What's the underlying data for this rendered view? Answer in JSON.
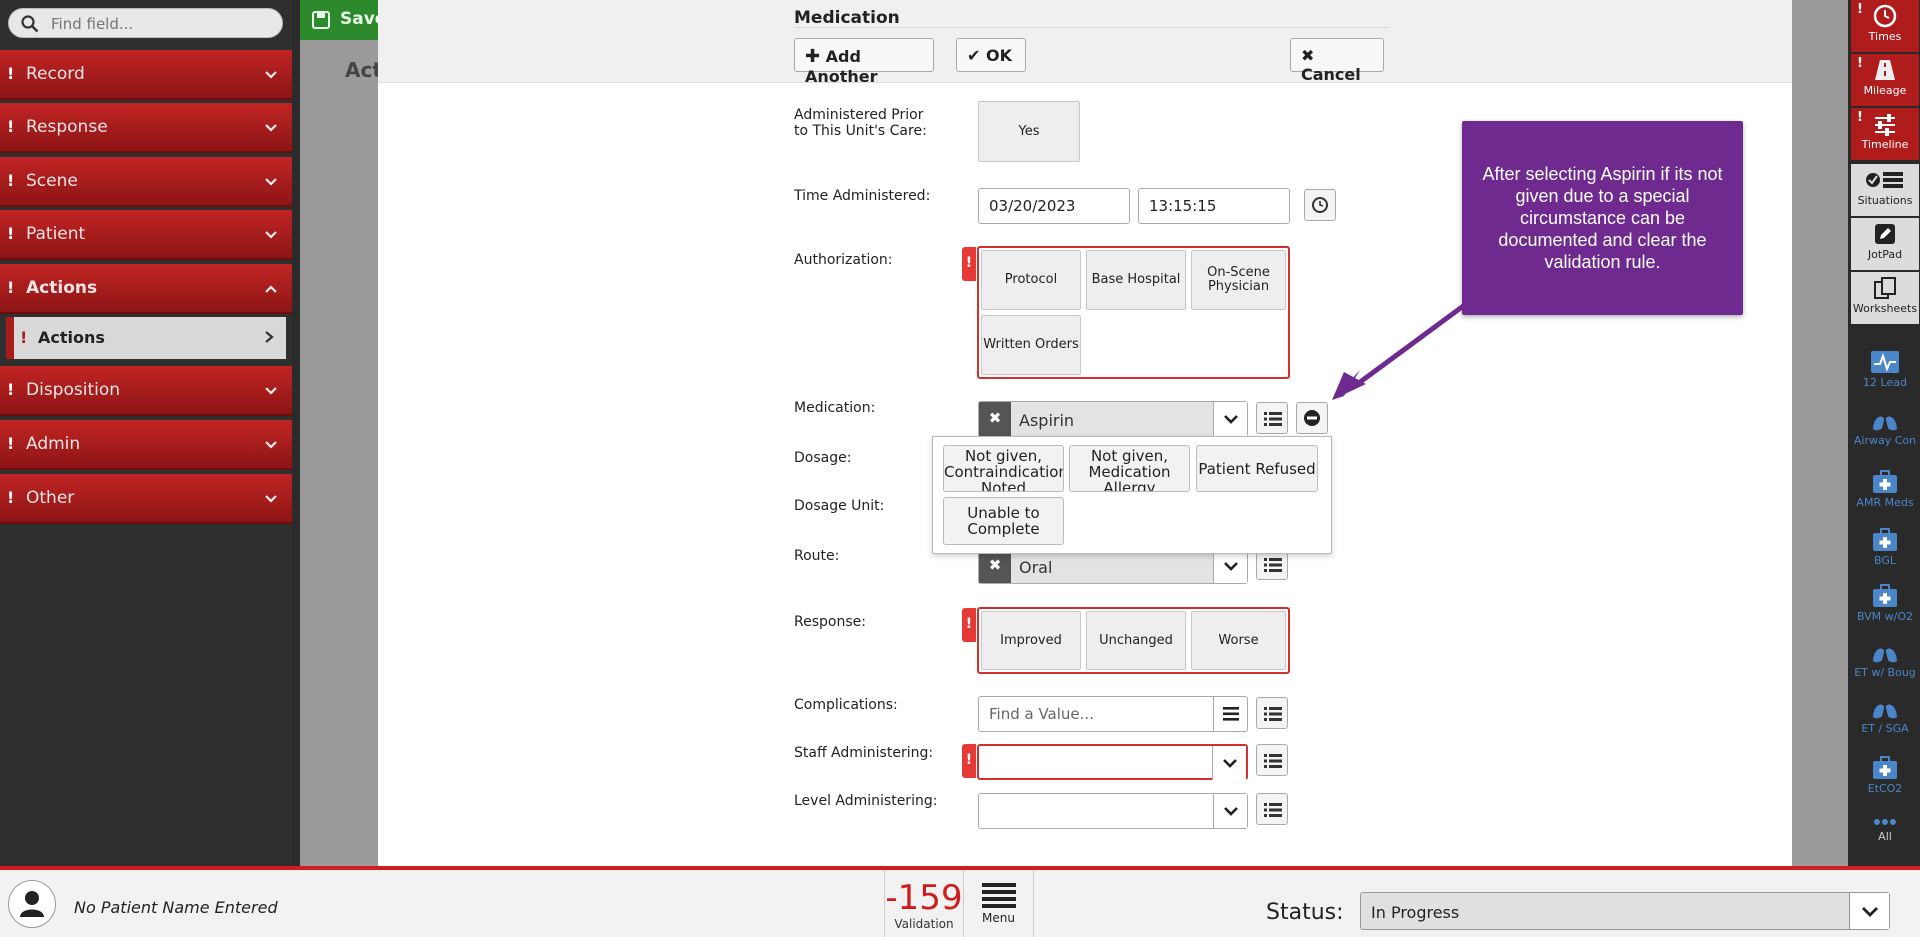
{
  "sidebar": {
    "search_placeholder": "Find field...",
    "items": [
      {
        "label": "Record",
        "alert": "!"
      },
      {
        "label": "Response",
        "alert": "!"
      },
      {
        "label": "Scene",
        "alert": "!"
      },
      {
        "label": "Patient",
        "alert": "!"
      },
      {
        "label": "Actions",
        "alert": "!"
      },
      {
        "label": "Disposition",
        "alert": "!"
      },
      {
        "label": "Admin",
        "alert": "!"
      },
      {
        "label": "Other",
        "alert": "!"
      }
    ],
    "sub_item": {
      "label": "Actions",
      "alert": "!"
    }
  },
  "background": {
    "save_label": "Save",
    "title": "Act"
  },
  "modal": {
    "title": "Medication",
    "add_another": "Add Another",
    "ok": "OK",
    "cancel": "Cancel",
    "fields": {
      "administered_prior_label": "Administered Prior to This Unit's Care:",
      "administered_prior_value": "Yes",
      "time_label": "Time Administered:",
      "date_value": "03/20/2023",
      "time_value": "13:15:15",
      "authorization_label": "Authorization:",
      "authorization_options": [
        "Protocol",
        "Base Hospital",
        "On-Scene Physician",
        "Written Orders"
      ],
      "medication_label": "Medication:",
      "medication_value": "Aspirin",
      "dosage_label": "Dosage:",
      "dosage_unit_label": "Dosage Unit:",
      "route_label": "Route:",
      "route_value": "Oral",
      "response_label": "Response:",
      "response_options": [
        "Improved",
        "Unchanged",
        "Worse"
      ],
      "complications_label": "Complications:",
      "complications_placeholder": "Find a Value...",
      "staff_label": "Staff Administering:",
      "level_label": "Level Administering:"
    },
    "popup_options": [
      "Not given, Contraindication Noted",
      "Not given, Medication Allergy",
      "Patient Refused",
      "Unable to Complete"
    ]
  },
  "callout": {
    "text": "After selecting Aspirin if its not given due to a special circumstance can be documented and clear the validation rule."
  },
  "rightbar": [
    {
      "label": "Times",
      "icon": "clock-icon"
    },
    {
      "label": "Mileage",
      "icon": "road-icon"
    },
    {
      "label": "Timeline",
      "icon": "sliders-icon"
    },
    {
      "label": "Situations",
      "icon": "situations-icon"
    },
    {
      "label": "JotPad",
      "icon": "pencil-icon"
    },
    {
      "label": "Worksheets",
      "icon": "copy-icon"
    },
    {
      "label": "12 Lead",
      "icon": "ecg-icon"
    },
    {
      "label": "Airway Con",
      "icon": "lungs-icon"
    },
    {
      "label": "AMR Meds",
      "icon": "medkit-icon"
    },
    {
      "label": "BGL",
      "icon": "medkit-icon"
    },
    {
      "label": "BVM w/O2",
      "icon": "medkit-icon"
    },
    {
      "label": "ET w/ Boug",
      "icon": "lungs-icon"
    },
    {
      "label": "ET / SGA",
      "icon": "lungs-icon"
    },
    {
      "label": "EtCO2",
      "icon": "medkit-icon"
    },
    {
      "label": "All",
      "icon": "more-icon"
    }
  ],
  "bottom": {
    "patient_name": "No Patient Name Entered",
    "validation_count": "-159",
    "validation_label": "Validation",
    "menu_label": "Menu",
    "status_label": "Status:",
    "status_value": "In Progress"
  },
  "colors": {
    "sidebar_red": "#b01c1c",
    "callout_purple": "#6f2a8f",
    "alert_red": "#e53935",
    "save_green": "#2c8a2c"
  }
}
